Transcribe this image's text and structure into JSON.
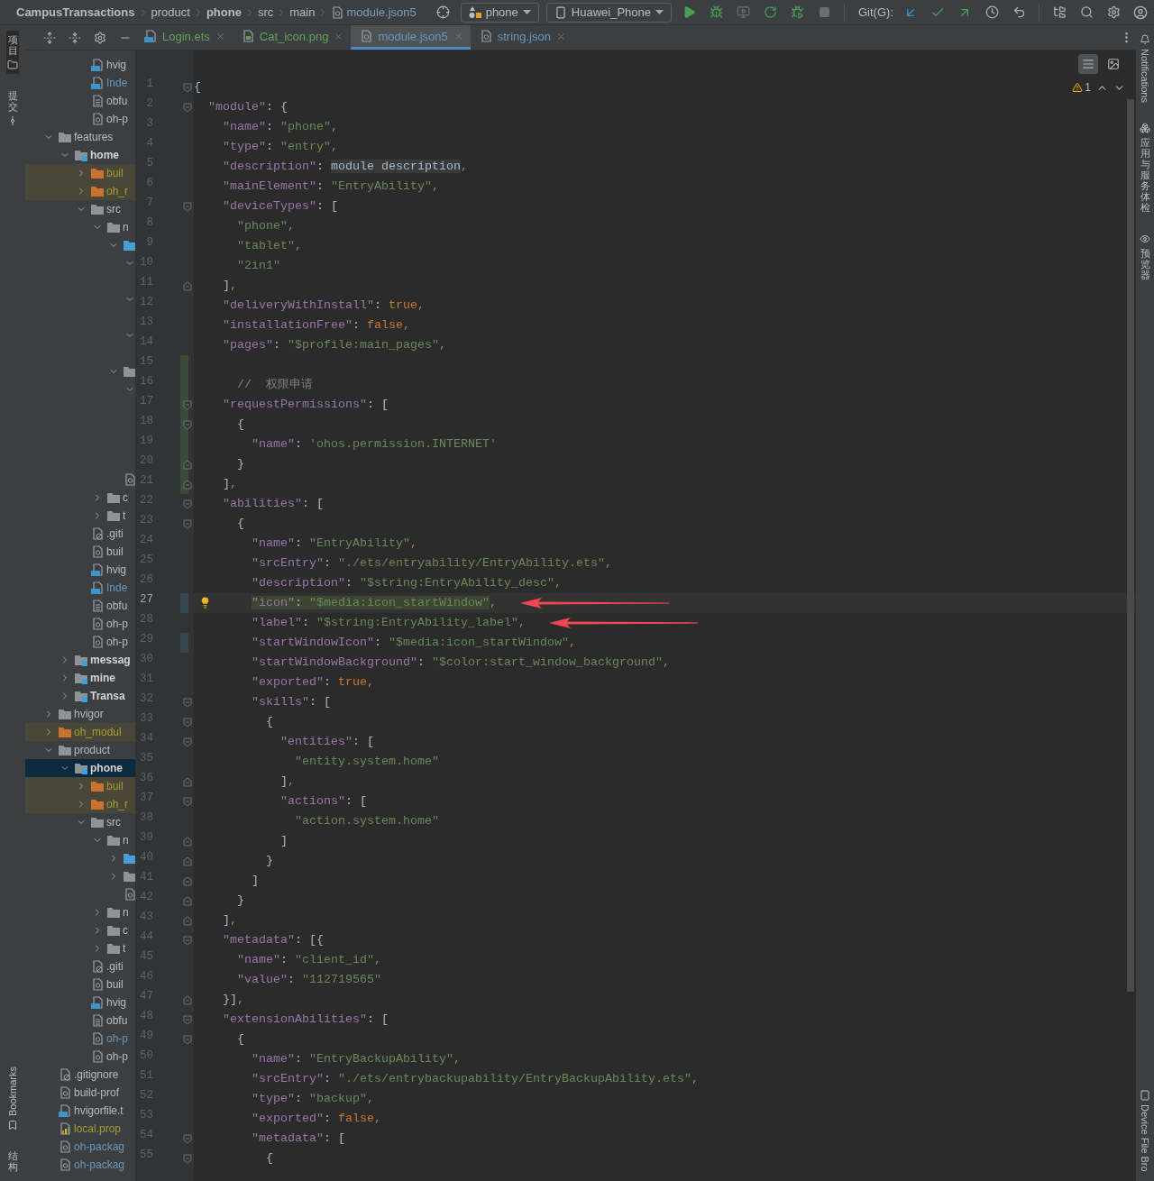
{
  "breadcrumbs": [
    {
      "label": "CampusTransactions",
      "kind": "project"
    },
    {
      "label": "product",
      "kind": "folder"
    },
    {
      "label": "phone",
      "kind": "module"
    },
    {
      "label": "src",
      "kind": "folder"
    },
    {
      "label": "main",
      "kind": "folder"
    },
    {
      "label": "module.json5",
      "kind": "file"
    }
  ],
  "toolbar": {
    "config": "phone",
    "device": "Huawei_Phone",
    "git_label": "Git(G):"
  },
  "left_tools": [
    {
      "label": "项目",
      "selected": true
    },
    {
      "label": "提交",
      "selected": false
    }
  ],
  "left_tools_bottom": [
    {
      "label": "Bookmarks",
      "kind": "latin"
    },
    {
      "label": "结构",
      "kind": "cjk"
    }
  ],
  "right_tools": [
    {
      "label": "Notifications",
      "kind": "latin"
    },
    {
      "label": "应用与服务体检",
      "kind": "cjk"
    },
    {
      "label": "预览器",
      "kind": "cjk"
    }
  ],
  "right_tools_bottom": [
    {
      "label": "Device File Bro",
      "kind": "latin"
    }
  ],
  "project_tree": {
    "continued_items": [
      {
        "label": "hvig",
        "kind": "file-ts",
        "selected": false
      },
      {
        "label": "Inde",
        "kind": "file-ets",
        "color": "#6897bb",
        "selected": false
      },
      {
        "label": "obfu",
        "kind": "file-text",
        "selected": false
      },
      {
        "label": "oh-p",
        "kind": "file-json",
        "selected": false
      }
    ],
    "items": [
      {
        "label": "features",
        "kind": "folder",
        "expanded": true,
        "selected": false,
        "children": [
          {
            "label": "home",
            "kind": "module",
            "expanded": true,
            "selected": false,
            "children": [
              {
                "label": "buil",
                "kind": "folder",
                "excluded": true,
                "color": "#a39f36",
                "expanded": false,
                "selected": false
              },
              {
                "label": "oh_r",
                "kind": "folder",
                "excluded": true,
                "color": "#a39f36",
                "expanded": false,
                "selected": false
              },
              {
                "label": "src",
                "kind": "folder",
                "expanded": true,
                "selected": false,
                "children": [
                  {
                    "label": "n",
                    "kind": "folder",
                    "expanded": true,
                    "selected": false,
                    "children": [
                      {
                        "kind": "source-folder",
                        "expanded": true,
                        "selected": false,
                        "children": [
                          {
                            "expanded": true,
                            "selected": false,
                            "children": [
                              {
                                "selected": false
                              }
                            ]
                          },
                          {
                            "expanded": true,
                            "selected": false,
                            "children": [
                              {
                                "selected": false
                              }
                            ]
                          },
                          {
                            "expanded": true,
                            "selected": false,
                            "children": [
                              {
                                "selected": false
                              }
                            ]
                          }
                        ]
                      },
                      {
                        "kind": "folder",
                        "expanded": true,
                        "selected": false,
                        "children": [
                          {
                            "expanded": true,
                            "selected": false,
                            "children": [
                              {
                                "selected": false
                              },
                              {
                                "selected": false
                              },
                              {
                                "selected": false
                              },
                              {
                                "selected": false
                              }
                            ]
                          }
                        ]
                      },
                      {
                        "kind": "file-json",
                        "selected": false
                      }
                    ]
                  },
                  {
                    "label": "c",
                    "kind": "folder",
                    "expanded": false,
                    "selected": false
                  },
                  {
                    "label": "t",
                    "kind": "folder",
                    "expanded": false,
                    "selected": false
                  }
                ]
              },
              {
                "label": ".giti",
                "kind": "file-gitignore",
                "selected": false
              },
              {
                "label": "buil",
                "kind": "file-json",
                "selected": false
              },
              {
                "label": "hvig",
                "kind": "file-ts",
                "selected": false
              },
              {
                "label": "Inde",
                "kind": "file-ets",
                "color": "#6897bb",
                "selected": false
              },
              {
                "label": "obfu",
                "kind": "file-text",
                "selected": false
              },
              {
                "label": "oh-p",
                "kind": "file-json",
                "selected": false
              },
              {
                "label": "oh-p",
                "kind": "file-json",
                "selected": false
              }
            ]
          },
          {
            "label": "messag",
            "kind": "module",
            "expanded": false,
            "selected": false
          },
          {
            "label": "mine",
            "kind": "module",
            "expanded": false,
            "selected": false
          },
          {
            "label": "Transa",
            "kind": "module",
            "expanded": false,
            "selected": false
          }
        ]
      },
      {
        "label": "hvigor",
        "kind": "folder",
        "expanded": false,
        "selected": false
      },
      {
        "label": "oh_modul",
        "kind": "folder",
        "excluded": true,
        "color": "#a39f36",
        "expanded": false,
        "selected": false
      },
      {
        "label": "product",
        "kind": "folder",
        "expanded": true,
        "selected": false,
        "children": [
          {
            "label": "phone",
            "kind": "module",
            "expanded": true,
            "selected": true,
            "children": [
              {
                "label": "buil",
                "kind": "folder",
                "excluded": true,
                "color": "#a39f36",
                "expanded": false,
                "selected": false
              },
              {
                "label": "oh_r",
                "kind": "folder",
                "excluded": true,
                "color": "#a39f36",
                "expanded": false,
                "selected": false
              },
              {
                "label": "src",
                "kind": "folder",
                "expanded": true,
                "selected": false,
                "children": [
                  {
                    "label": "n",
                    "kind": "folder",
                    "expanded": true,
                    "selected": false,
                    "children": [
                      {
                        "kind": "source-folder",
                        "expanded": false,
                        "selected": false
                      },
                      {
                        "kind": "folder",
                        "expanded": false,
                        "selected": false
                      },
                      {
                        "kind": "file-json",
                        "selected": false
                      }
                    ]
                  },
                  {
                    "label": "n",
                    "kind": "folder",
                    "expanded": false,
                    "selected": false
                  },
                  {
                    "label": "c",
                    "kind": "folder",
                    "expanded": false,
                    "selected": false
                  },
                  {
                    "label": "t",
                    "kind": "folder",
                    "expanded": false,
                    "selected": false
                  }
                ]
              },
              {
                "label": ".giti",
                "kind": "file-gitignore",
                "selected": false
              },
              {
                "label": "buil",
                "kind": "file-json",
                "selected": false
              },
              {
                "label": "hvig",
                "kind": "file-ts",
                "selected": false
              },
              {
                "label": "obfu",
                "kind": "file-text",
                "selected": false
              },
              {
                "label": "oh-p",
                "kind": "file-json",
                "color": "#6897bb",
                "selected": false
              },
              {
                "label": "oh-p",
                "kind": "file-json",
                "selected": false
              }
            ]
          }
        ]
      },
      {
        "label": ".gitignore",
        "kind": "file-gitignore",
        "selected": false
      },
      {
        "label": "build-prof",
        "kind": "file-json",
        "selected": false
      },
      {
        "label": "hvigorfile.t",
        "kind": "file-ts",
        "selected": false
      },
      {
        "label": "local.prop",
        "kind": "file-properties",
        "color": "#a39f36",
        "selected": false
      },
      {
        "label": "oh-packag",
        "kind": "file-json",
        "color": "#6897bb",
        "selected": false
      },
      {
        "label": "oh-packag",
        "kind": "file-json",
        "color": "#6897bb",
        "selected": false
      }
    ]
  },
  "tabs": [
    {
      "label": "Login.ets",
      "kind": "ets",
      "color": "#62a056",
      "selected": false
    },
    {
      "label": "Cat_icon.png",
      "kind": "image",
      "color": "#62a056",
      "selected": false
    },
    {
      "label": "module.json5",
      "kind": "json",
      "color": "#6897bb",
      "selected": true
    },
    {
      "label": "string.json",
      "kind": "json",
      "color": "#6897bb",
      "selected": false
    }
  ],
  "editor": {
    "warnings": "1",
    "lines": [
      {
        "n": "1",
        "fold_start": true,
        "text": "{"
      },
      {
        "n": "2",
        "fold_start": true,
        "text": "  \"module\": {"
      },
      {
        "n": "3",
        "text": "    \"name\": \"phone\","
      },
      {
        "n": "4",
        "text": "    \"type\": \"entry\","
      },
      {
        "n": "5",
        "text": "    \"description\": module description,"
      },
      {
        "n": "6",
        "text": "    \"mainElement\": \"EntryAbility\","
      },
      {
        "n": "7",
        "fold_start": true,
        "text": "    \"deviceTypes\": ["
      },
      {
        "n": "8",
        "text": "      \"phone\","
      },
      {
        "n": "9",
        "text": "      \"tablet\","
      },
      {
        "n": "10",
        "text": "      \"2in1\""
      },
      {
        "n": "11",
        "fold_end": true,
        "text": "    ],"
      },
      {
        "n": "12",
        "text": "    \"deliveryWithInstall\": true,"
      },
      {
        "n": "13",
        "text": "    \"installationFree\": false,"
      },
      {
        "n": "14",
        "text": "    \"pages\": \"$profile:main_pages\","
      },
      {
        "n": "15",
        "added": true
      },
      {
        "n": "16",
        "added": true,
        "text": "      //  权限申请"
      },
      {
        "n": "17",
        "fold_start": true,
        "added": true,
        "text": "    \"requestPermissions\": ["
      },
      {
        "n": "18",
        "fold_start": true,
        "added": true,
        "text": "      {"
      },
      {
        "n": "19",
        "added": true,
        "text": "        \"name\": 'ohos.permission.INTERNET'"
      },
      {
        "n": "20",
        "fold_end": true,
        "added": true,
        "text": "      }"
      },
      {
        "n": "21",
        "fold_end": true,
        "added": true,
        "text": "    ],"
      },
      {
        "n": "22",
        "fold_start": true,
        "text": "    \"abilities\": ["
      },
      {
        "n": "23",
        "fold_start": true,
        "text": "      {"
      },
      {
        "n": "24",
        "text": "        \"name\": \"EntryAbility\","
      },
      {
        "n": "25",
        "text": "        \"srcEntry\": \"./ets/entryability/EntryAbility.ets\","
      },
      {
        "n": "26",
        "text": "        \"description\": \"$string:EntryAbility_desc\","
      },
      {
        "n": "27",
        "current": true,
        "highlighted": true,
        "modified": true,
        "bulb": true,
        "arrow": true,
        "text": "        \"icon\": \"$media:icon_startWindow\","
      },
      {
        "n": "28",
        "arrow": true,
        "text": "        \"label\": \"$string:EntryAbility_label\","
      },
      {
        "n": "29",
        "modified": true,
        "text": "        \"startWindowIcon\": \"$media:icon_startWindow\","
      },
      {
        "n": "30",
        "text": "        \"startWindowBackground\": \"$color:start_window_background\","
      },
      {
        "n": "31",
        "text": "        \"exported\": true,"
      },
      {
        "n": "32",
        "fold_start": true,
        "text": "        \"skills\": ["
      },
      {
        "n": "33",
        "fold_start": true,
        "text": "          {"
      },
      {
        "n": "34",
        "fold_start": true,
        "text": "            \"entities\": ["
      },
      {
        "n": "35",
        "text": "              \"entity.system.home\""
      },
      {
        "n": "36",
        "fold_end": true,
        "text": "            ],"
      },
      {
        "n": "37",
        "fold_start": true,
        "text": "            \"actions\": ["
      },
      {
        "n": "38",
        "text": "              \"action.system.home\""
      },
      {
        "n": "39",
        "fold_end": true,
        "text": "            ]"
      },
      {
        "n": "40",
        "fold_end": true,
        "text": "          }"
      },
      {
        "n": "41",
        "fold_end": true,
        "text": "        ]"
      },
      {
        "n": "42",
        "fold_end": true,
        "text": "      }"
      },
      {
        "n": "43",
        "fold_end": true,
        "text": "    ],"
      },
      {
        "n": "44",
        "fold_start": true,
        "text": "    \"metadata\": [{"
      },
      {
        "n": "45",
        "text": "      \"name\": \"client_id\","
      },
      {
        "n": "46",
        "text": "      \"value\": \"112719565\""
      },
      {
        "n": "47",
        "fold_end": true,
        "text": "    }],"
      },
      {
        "n": "48",
        "fold_start": true,
        "text": "    \"extensionAbilities\": ["
      },
      {
        "n": "49",
        "fold_start": true,
        "text": "      {"
      },
      {
        "n": "50",
        "text": "        \"name\": \"EntryBackupAbility\","
      },
      {
        "n": "51",
        "text": "        \"srcEntry\": \"./ets/entrybackupability/EntryBackupAbility.ets\","
      },
      {
        "n": "52",
        "text": "        \"type\": \"backup\","
      },
      {
        "n": "53",
        "text": "        \"exported\": false,"
      },
      {
        "n": "54",
        "fold_start": true,
        "text": "        \"metadata\": ["
      },
      {
        "n": "55",
        "fold_start": true,
        "text": "          {"
      }
    ]
  }
}
